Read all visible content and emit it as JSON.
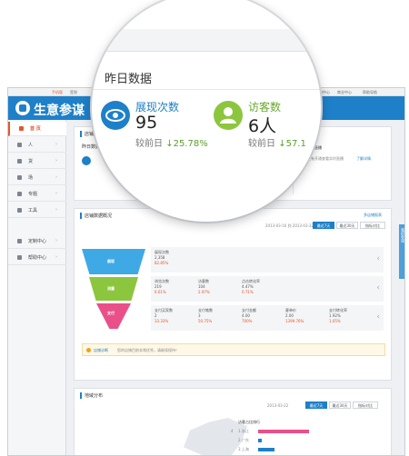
{
  "topbar": {
    "items": [
      "手机版",
      "签到",
      "客服中心",
      "商业中心",
      "帮助导航"
    ]
  },
  "header": {
    "logo": "生意参谋"
  },
  "sidebar": {
    "items": [
      {
        "label": "首 页",
        "active": true
      },
      {
        "label": "人"
      },
      {
        "label": "货"
      },
      {
        "label": "场"
      },
      {
        "label": "专题"
      },
      {
        "label": "工具"
      },
      {
        "label": "定制中心"
      },
      {
        "label": "帮助中心"
      }
    ]
  },
  "realtime": {
    "title": "店铺实时",
    "sub": "昨日数据",
    "live_title": "今日实时直播",
    "live_text": "您还没有开通查看实时直播",
    "live_link": "了解详情"
  },
  "overview": {
    "title": "店铺数据概况",
    "link": "多店铺报表",
    "date_range": "2013-03-16 到 2013-03-22",
    "tabs": [
      "最近7天",
      "最近30天",
      "指标对比"
    ],
    "stages": [
      {
        "label": "展现",
        "color": "#3fa9e6"
      },
      {
        "label": "流量",
        "color": "#8cc63f"
      },
      {
        "label": "支付",
        "color": "#e9508a"
      }
    ],
    "rows": [
      {
        "cols": [
          {
            "name": "展现次数",
            "value": "2,358",
            "change": "82.85%"
          }
        ]
      },
      {
        "cols": [
          {
            "name": "浏览次数",
            "value": "219",
            "change": "6.61%"
          },
          {
            "name": "访客数",
            "value": "104",
            "change": "2.97%"
          },
          {
            "name": "点击转化率",
            "value": "4.47%",
            "change": "0.71%"
          }
        ]
      },
      {
        "cols": [
          {
            "name": "支付买家数",
            "value": "2",
            "change": "33.33%"
          },
          {
            "name": "支付笔数",
            "value": "3",
            "change": "50.75%"
          },
          {
            "name": "支付金额",
            "value": "4.00",
            "change": "700%"
          },
          {
            "name": "客单价",
            "value": "2.00",
            "change": "1399.76%"
          },
          {
            "name": "支付转化率",
            "value": "1.92%",
            "change": "1.05%"
          }
        ]
      }
    ],
    "tip_label": "店铺诊断",
    "tip_text": "您的店铺目前非常优秀，请继续保持！"
  },
  "region": {
    "title": "地域分布",
    "date": "2013-03-22",
    "tabs": [
      "最近7天",
      "最近30天",
      "指标对比"
    ],
    "chart_title": "访客占比排行",
    "rows": [
      {
        "label": "1.浙江",
        "value": "4"
      },
      {
        "label": "2.广东",
        "value": ""
      },
      {
        "label": "3.上海",
        "value": ""
      }
    ]
  },
  "right_strip": "我的参谋",
  "magnifier": {
    "title": "昨日数据",
    "metrics": [
      {
        "label": "展现次数",
        "value": "95",
        "compare_label": "较前日",
        "compare_value": "25.78%",
        "color": "#1e80c9"
      },
      {
        "label": "访客数",
        "value": "6人",
        "compare_label": "较前日",
        "compare_value": "57.1",
        "color": "#6aa82d"
      }
    ]
  }
}
